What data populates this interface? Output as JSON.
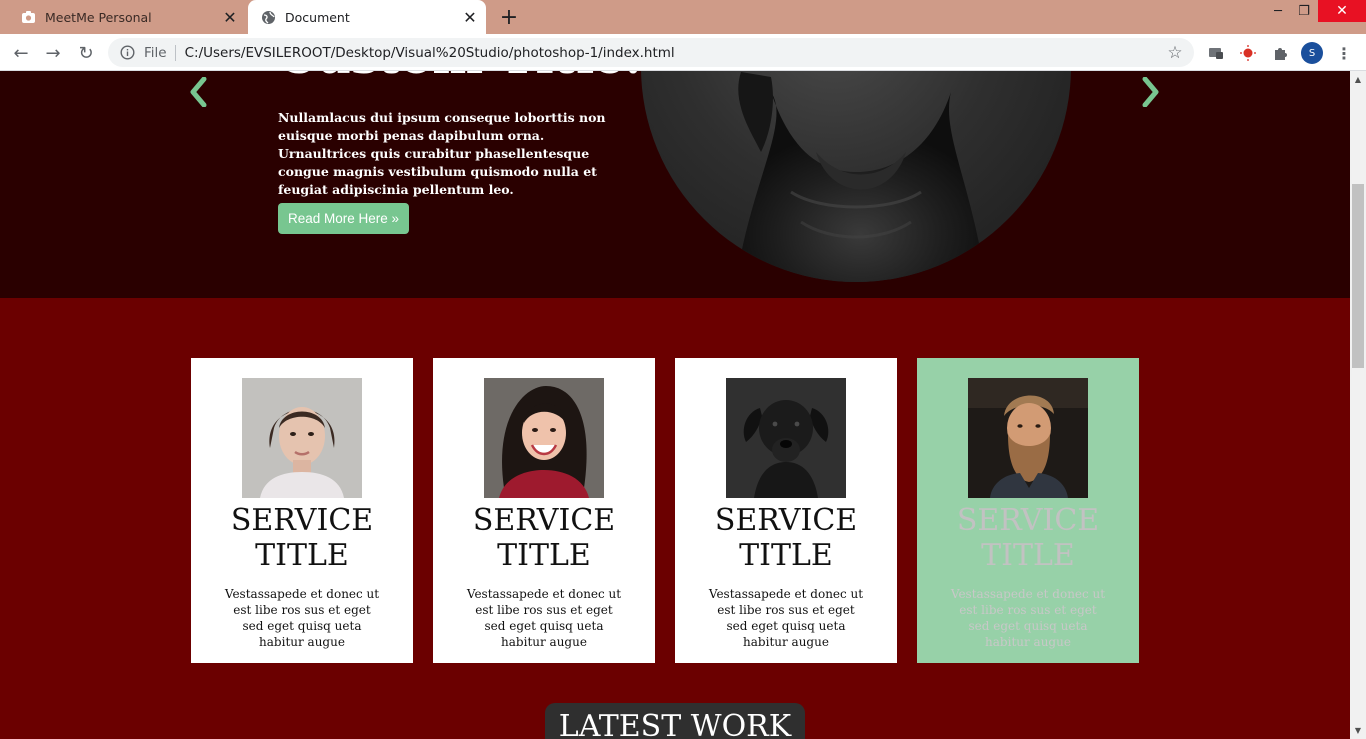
{
  "browser": {
    "tabs": [
      {
        "title": "MeetMe Personal",
        "active": false
      },
      {
        "title": "Document",
        "active": true
      }
    ],
    "address": {
      "scheme_label": "File",
      "url": "C:/Users/EVSILEROOT/Desktop/Visual%20Studio/photoshop-1/index.html"
    },
    "profile_initial": "S",
    "tab_close_glyph": "✕",
    "new_tab_glyph": "+",
    "window_controls": {
      "minimize": "─",
      "maximize": "❐",
      "close": "✕"
    },
    "nav_glyphs": {
      "back": "←",
      "forward": "→",
      "reload": "↻"
    },
    "star_glyph": "☆",
    "menu_glyph": "⋮"
  },
  "hero": {
    "title_fragment": "Custom Title.",
    "text": "Nullamlacus dui ipsum conseque loborttis non euisque morbi penas dapibulum orna. Urnaultrices quis curabitur phasellentesque congue magnis vestibulum quismodo nulla et feugiat adipiscinia pellentum leo.",
    "button_label": "Read More Here »",
    "accent_color": "#78c690"
  },
  "services": {
    "cards": [
      {
        "title": "SERVICE TITLE",
        "text": "Vestassapede et donec ut est libe ros sus et eget sed eget quisq ueta habitur augue",
        "photo": "woman-portrait"
      },
      {
        "title": "SERVICE TITLE",
        "text": "Vestassapede et donec ut est libe ros sus et eget sed eget quisq ueta habitur augue",
        "photo": "smiling-woman-portrait"
      },
      {
        "title": "SERVICE TITLE",
        "text": "Vestassapede et donec ut est libe ros sus et eget sed eget quisq ueta habitur augue",
        "photo": "black-dog-portrait"
      },
      {
        "title": "SERVICE TITLE",
        "text": "Vestassapede et donec ut est libe ros sus et eget sed eget quisq ueta habitur augue",
        "photo": "bearded-man-portrait",
        "highlighted": true
      }
    ],
    "highlight_color": "#97d1a8"
  },
  "latest_work": {
    "heading": "LATEST WORK"
  },
  "colors": {
    "hero_background": "#2a0000",
    "section_background": "#6b0000",
    "tabbar_background": "#cf9b88"
  }
}
